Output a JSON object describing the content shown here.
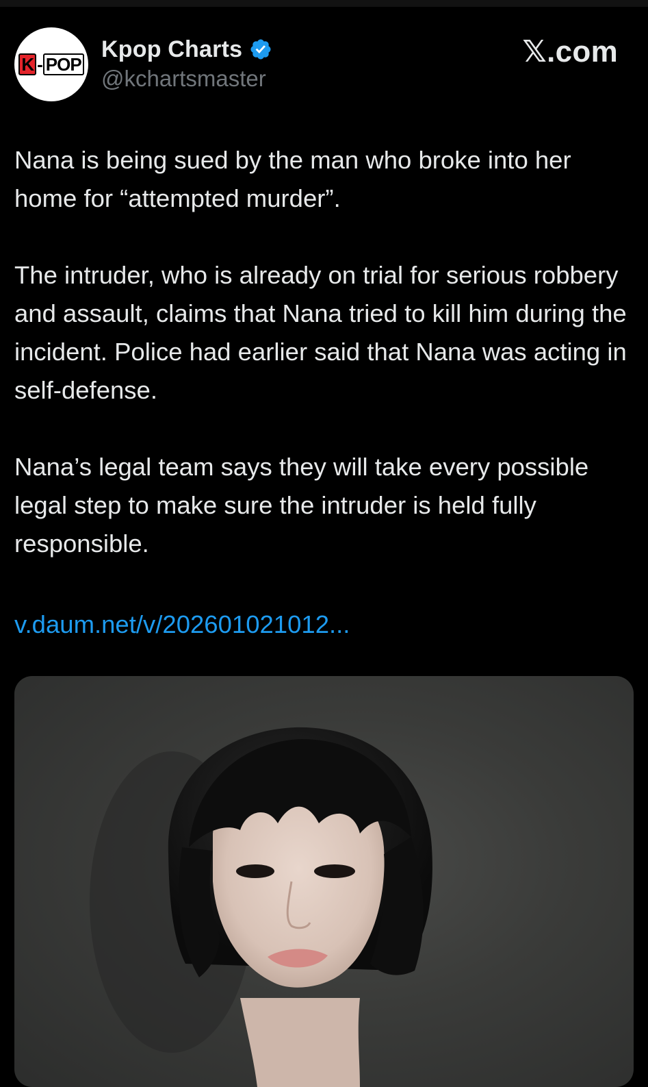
{
  "post": {
    "author": {
      "display_name": "Kpop Charts",
      "handle": "@kchartsmaster",
      "verified": true,
      "avatar_logo": {
        "left": "K",
        "separator": "-",
        "right": "POP"
      }
    },
    "site_brand": "𝕏.com",
    "paragraphs": [
      "Nana is being sued by the man who broke into her home for “attempted murder”.",
      "The intruder, who is already on trial for serious robbery and assault, claims that Nana tried to kill him during the incident. Police had earlier said that Nana was acting in self-defense.",
      "Nana’s legal team says they will take every possible legal step to make sure the intruder is held fully responsible."
    ],
    "link_text": "v.daum.net/v/202601021012..."
  },
  "colors": {
    "background": "#000000",
    "text": "#e7e9ea",
    "secondary_text": "#71767b",
    "link": "#1d9bf0",
    "verified_badge": "#1d9bf0"
  },
  "icons": {
    "verified": "verified-badge-icon"
  }
}
